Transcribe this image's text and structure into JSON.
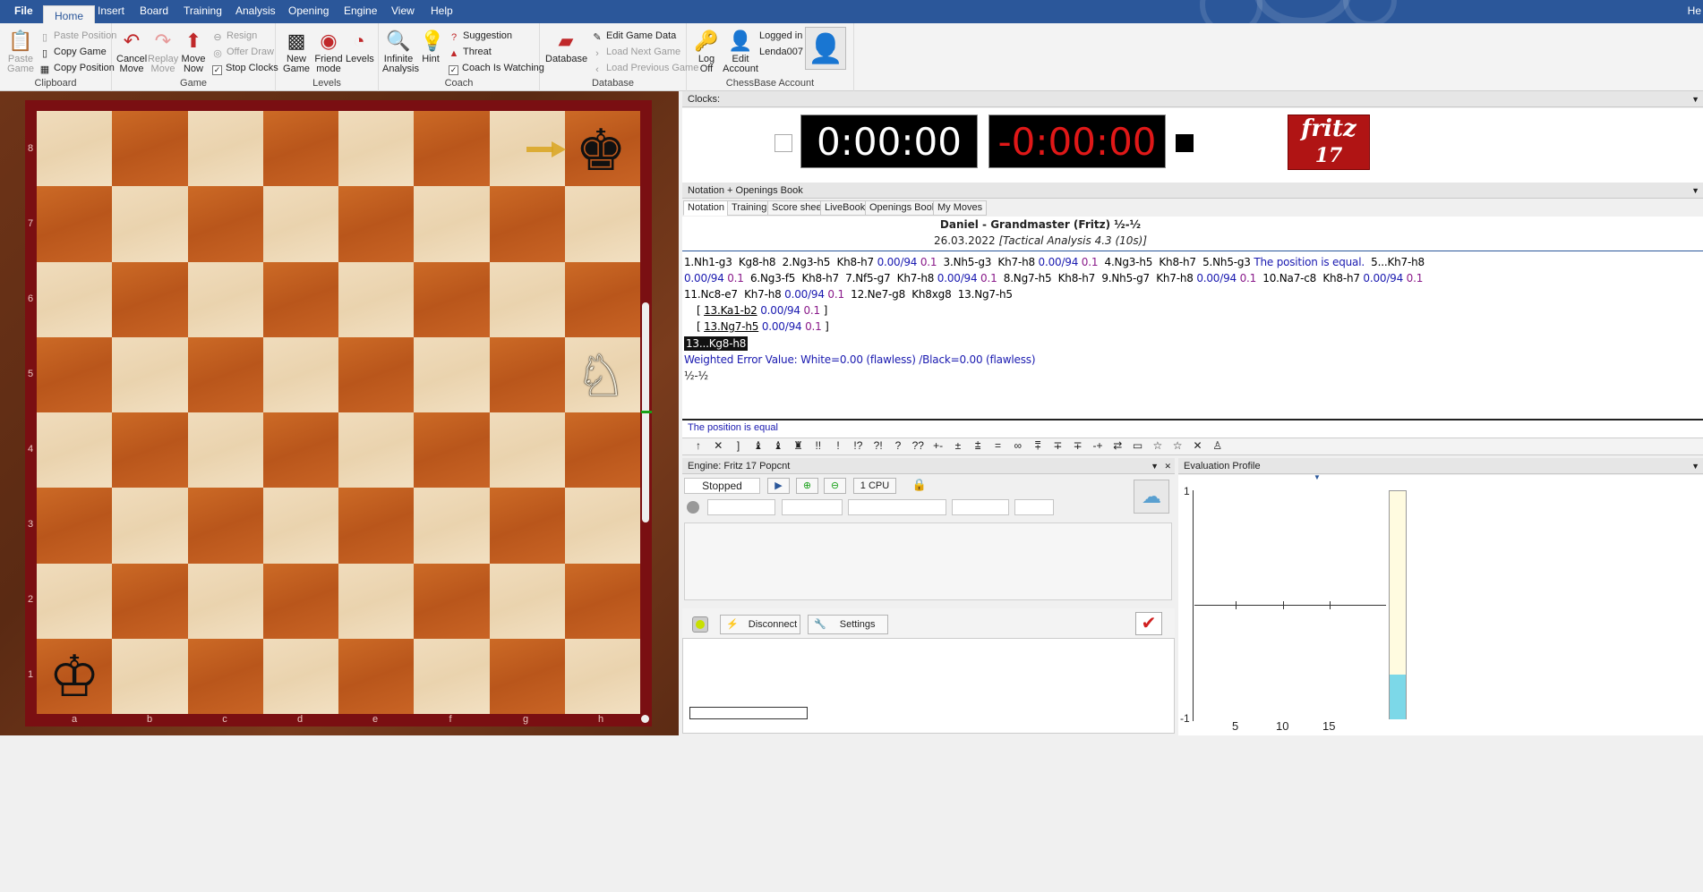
{
  "tabs": {
    "file": "File",
    "items": [
      "Home",
      "Insert",
      "Board",
      "Training",
      "Analysis",
      "Opening",
      "Engine",
      "View",
      "Help"
    ],
    "right": "He"
  },
  "ribbon": {
    "clipboard": {
      "paste": "Paste\nGame",
      "paste_position": "Paste Position",
      "copy_game": "Copy Game",
      "copy_position": "Copy Position",
      "group": "Clipboard"
    },
    "game": {
      "cancel": "Cancel\nMove",
      "replay": "Replay\nMove",
      "move_now": "Move\nNow",
      "resign": "Resign",
      "offer_draw": "Offer Draw",
      "stop_clocks": "Stop Clocks",
      "group": "Game"
    },
    "levels": {
      "new_game": "New\nGame",
      "friend": "Friend\nmode",
      "levels": "Levels",
      "group": "Levels"
    },
    "coach": {
      "infinite": "Infinite\nAnalysis",
      "hint": "Hint",
      "suggestion": "Suggestion",
      "threat": "Threat",
      "coach_watching": "Coach Is Watching",
      "group": "Coach"
    },
    "database": {
      "database": "Database",
      "edit_game_data": "Edit Game Data",
      "load_next": "Load Next Game",
      "load_prev": "Load Previous Game",
      "group": "Database"
    },
    "account": {
      "log_off": "Log\nOff",
      "edit_account": "Edit\nAccount",
      "logged_in": "Logged in",
      "user": "Lenda007",
      "group": "ChessBase Account"
    }
  },
  "board": {
    "ranks": [
      "8",
      "7",
      "6",
      "5",
      "4",
      "3",
      "2",
      "1"
    ],
    "files": [
      "a",
      "b",
      "c",
      "d",
      "e",
      "f",
      "g",
      "h"
    ],
    "black_king": "♚",
    "white_king": "♔",
    "white_knight": "♘"
  },
  "clocks": {
    "header": "Clocks:",
    "white": "0:00:00",
    "black": "-0:00:00",
    "logo": "fritz",
    "logo_num": "17"
  },
  "notation": {
    "header": "Notation + Openings Book",
    "tabs": [
      "Notation",
      "Training",
      "Score sheet",
      "LiveBook",
      "Openings Book",
      "My Moves"
    ],
    "players": "Daniel - Grandmaster (Fritz)  ½-½",
    "date": "26.03.2022",
    "event": "[Tactical Analysis 4.3 (10s)]",
    "line1": [
      {
        "t": "1.Nh1-g3  Kg8-h8  2.Ng3-h5  Kh8-h7 ",
        "c": "mv"
      },
      {
        "t": "0.00/94 ",
        "c": "ev"
      },
      {
        "t": "0.1 ",
        "c": "dp"
      },
      {
        "t": " 3.Nh5-g3  Kh7-h8 ",
        "c": "mv"
      },
      {
        "t": "0.00/94 ",
        "c": "ev"
      },
      {
        "t": "0.1 ",
        "c": "dp"
      },
      {
        "t": " 4.Ng3-h5  Kh8-h7  5.Nh5-g3 ",
        "c": "mv"
      },
      {
        "t": "The position is equal. ",
        "c": "cm"
      },
      {
        "t": " 5...Kh7-h8",
        "c": "mv"
      }
    ],
    "line2": [
      {
        "t": "0.00/94 ",
        "c": "ev"
      },
      {
        "t": "0.1 ",
        "c": "dp"
      },
      {
        "t": " 6.Ng3-f5  Kh8-h7  7.Nf5-g7  Kh7-h8 ",
        "c": "mv"
      },
      {
        "t": "0.00/94 ",
        "c": "ev"
      },
      {
        "t": "0.1 ",
        "c": "dp"
      },
      {
        "t": " 8.Ng7-h5  Kh8-h7  9.Nh5-g7  Kh7-h8 ",
        "c": "mv"
      },
      {
        "t": "0.00/94 ",
        "c": "ev"
      },
      {
        "t": "0.1 ",
        "c": "dp"
      },
      {
        "t": " 10.Na7-c8  Kh8-h7 ",
        "c": "mv"
      },
      {
        "t": "0.00/94 ",
        "c": "ev"
      },
      {
        "t": "0.1",
        "c": "dp"
      }
    ],
    "line3": [
      {
        "t": "11.Nc8-e7  Kh7-h8 ",
        "c": "mv"
      },
      {
        "t": "0.00/94 ",
        "c": "ev"
      },
      {
        "t": "0.1 ",
        "c": "dp"
      },
      {
        "t": " 12.Ne7-g8  Kh8xg8  13.Ng7-h5",
        "c": "mv"
      }
    ],
    "var1": [
      {
        "t": "[ ",
        "c": "mv"
      },
      {
        "t": "13.Ka1-b2",
        "c": "mv"
      },
      {
        "t": " 0.00/94 ",
        "c": "ev"
      },
      {
        "t": "0.1",
        "c": "dp"
      },
      {
        "t": " ]",
        "c": "mv"
      }
    ],
    "var2": [
      {
        "t": "[ ",
        "c": "mv"
      },
      {
        "t": "13.Ng7-h5",
        "c": "mv"
      },
      {
        "t": " 0.00/94 ",
        "c": "ev"
      },
      {
        "t": "0.1",
        "c": "dp"
      },
      {
        "t": " ]",
        "c": "mv"
      }
    ],
    "current": "13...Kg8-h8",
    "weighted": "Weighted Error Value: White=0.00 (flawless) /Black=0.00 (flawless)",
    "result": "½-½",
    "status": "The position is equal"
  },
  "symbols": [
    "↑",
    "✕",
    "]",
    "♝",
    "♝",
    "♜",
    "!!",
    "!",
    "!?",
    "?!",
    "?",
    "??",
    "+-",
    "±",
    "⩲",
    "=",
    "∞",
    "⩱",
    "∓",
    "∓",
    "-+",
    "⇄",
    "▭",
    "☆",
    "☆",
    "✕",
    "♙"
  ],
  "engine": {
    "header": "Engine: Fritz 17 Popcnt",
    "status": "Stopped",
    "cpu": "1 CPU",
    "disconnect": "Disconnect",
    "settings": "Settings"
  },
  "eval": {
    "header": "Evaluation Profile",
    "y_max": "1",
    "y_min": "-1",
    "x_ticks": [
      "5",
      "10",
      "15"
    ]
  }
}
